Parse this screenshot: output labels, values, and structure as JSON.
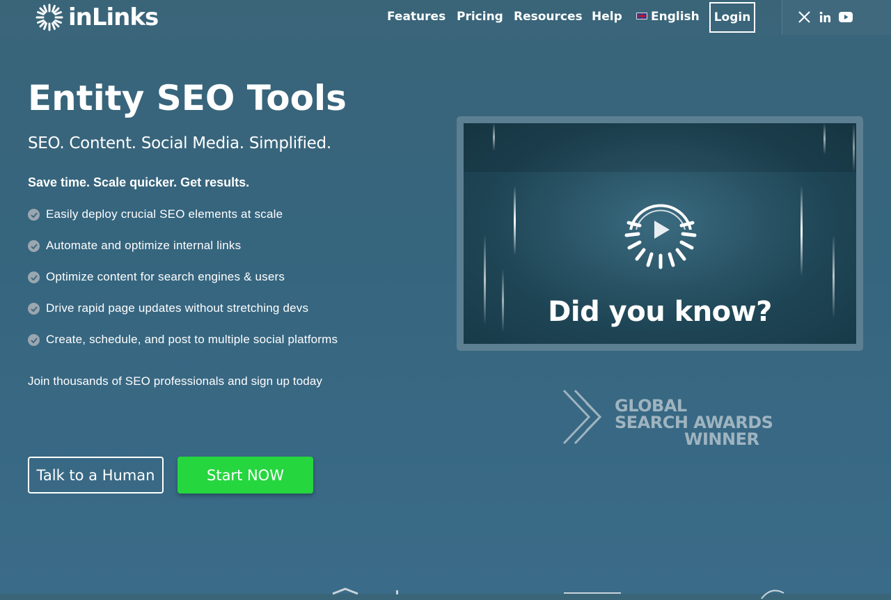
{
  "header": {
    "logo_text": "inLinks",
    "nav": [
      "Features",
      "Pricing",
      "Resources",
      "Help"
    ],
    "language": "English",
    "login_label": "Login",
    "social_icons": [
      "x-icon",
      "linkedin-icon",
      "youtube-icon"
    ]
  },
  "hero": {
    "title": "Entity SEO Tools",
    "subtitle": "SEO. Content. Social Media. Simplified.",
    "tagline": "Save time. Scale quicker. Get results.",
    "bullets": [
      "Easily deploy crucial SEO elements at scale",
      "Automate and optimize internal links",
      "Optimize content for search engines & users",
      "Drive rapid page updates without stretching devs",
      "Create, schedule, and post to multiple social platforms"
    ],
    "join_text": "Join thousands of SEO professionals and sign up today",
    "btn_talk": "Talk to a Human",
    "btn_start": "Start NOW"
  },
  "video": {
    "caption": "Did you know?"
  },
  "award": {
    "line1": "GLOBAL",
    "line2": "SEARCH AWARDS",
    "line3": "WINNER"
  },
  "colors": {
    "background": "#376780",
    "accent_green": "#26d63f",
    "check_grey": "#9aa6b0"
  }
}
